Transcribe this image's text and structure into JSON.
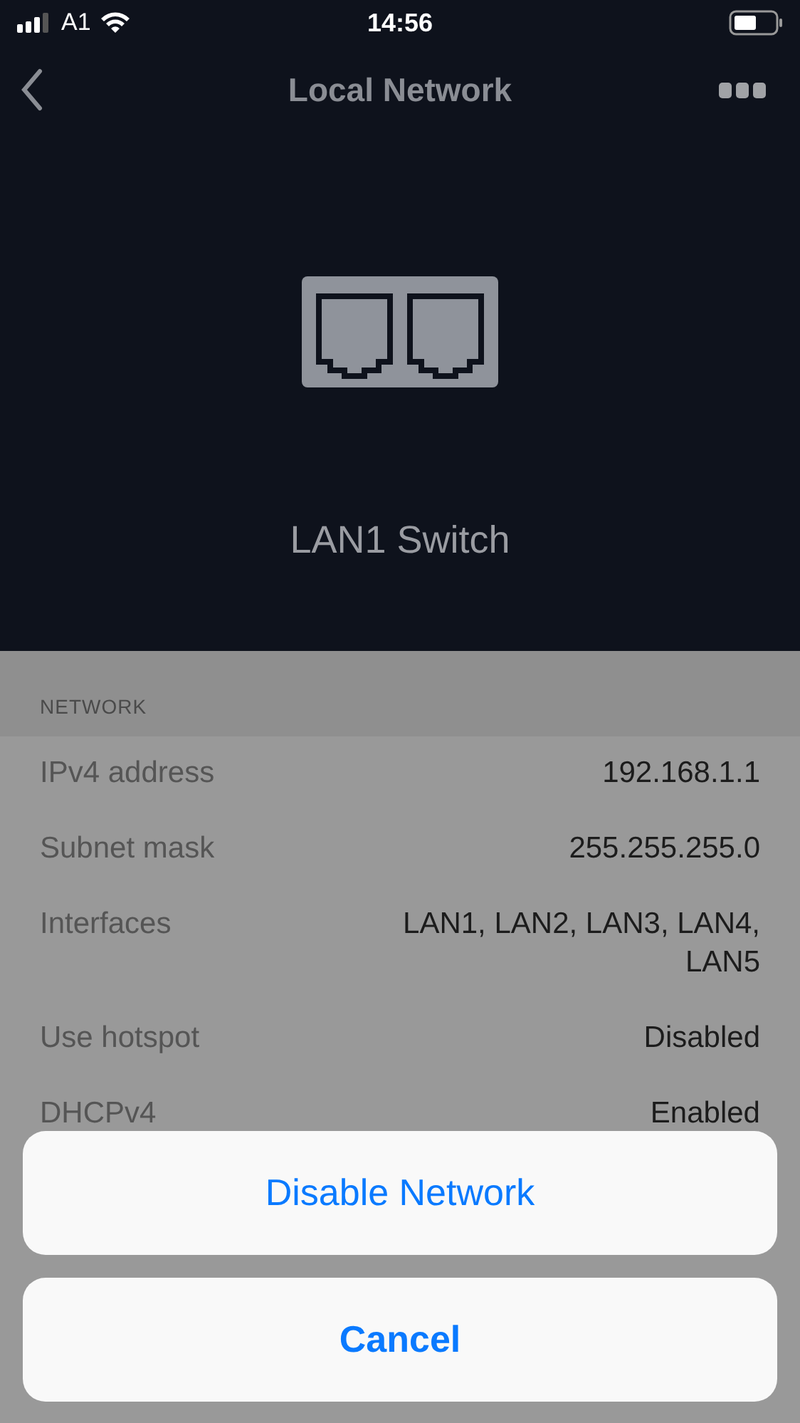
{
  "status_bar": {
    "carrier": "A1",
    "time": "14:56"
  },
  "nav": {
    "title": "Local Network"
  },
  "device": {
    "name": "LAN1 Switch"
  },
  "section": {
    "header": "NETWORK",
    "rows": [
      {
        "label": "IPv4 address",
        "value": "192.168.1.1"
      },
      {
        "label": "Subnet mask",
        "value": "255.255.255.0"
      },
      {
        "label": "Interfaces",
        "value": "LAN1, LAN2, LAN3, LAN4, LAN5"
      },
      {
        "label": "Use hotspot",
        "value": "Disabled"
      },
      {
        "label": "DHCPv4",
        "value": "Enabled"
      }
    ]
  },
  "action_sheet": {
    "actions": [
      {
        "label": "Disable Network"
      }
    ],
    "cancel": "Cancel"
  }
}
